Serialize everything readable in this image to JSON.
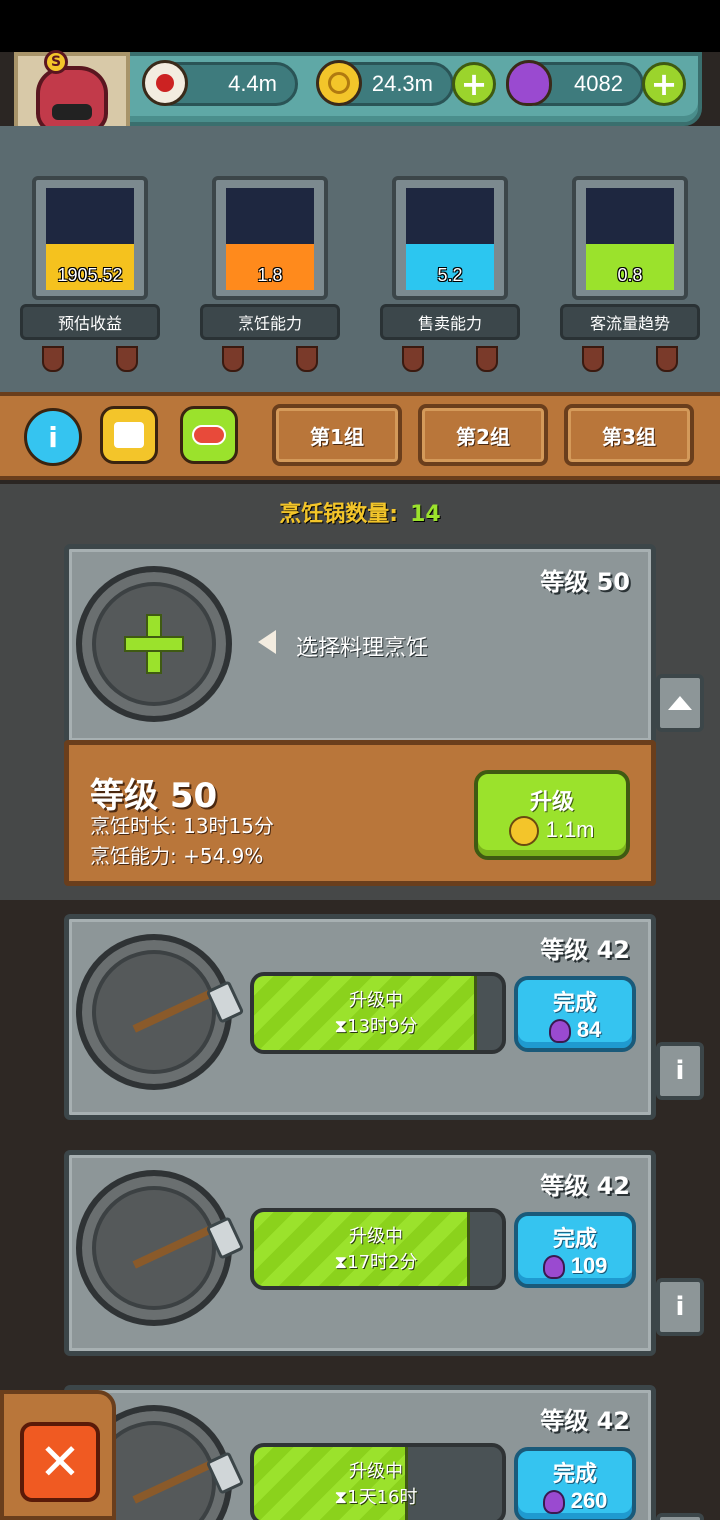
{
  "resources": {
    "eyes": "4.4m",
    "coins": "24.3m",
    "potions": "4082"
  },
  "stats": [
    {
      "value": "1905.52",
      "label": "预估收益",
      "color": "#f5c21e",
      "level": 0.45
    },
    {
      "value": "1.8",
      "label": "烹饪能力",
      "color": "#ff8a1c",
      "level": 0.45
    },
    {
      "value": "5.2",
      "label": "售卖能力",
      "color": "#2cc6f0",
      "level": 0.45
    },
    {
      "value": "0.8",
      "label": "客流量趋势",
      "color": "#9be22c",
      "level": 0.45
    }
  ],
  "toolbar": {
    "info_icon": "info-icon",
    "shirt_icon": "shirt-icon",
    "shoe_icon": "shoe-icon",
    "groups": [
      "第1组",
      "第2组",
      "第3组"
    ]
  },
  "pot_count": {
    "label": "烹饪锅数量:",
    "value": "14"
  },
  "card1": {
    "level": "等级 50",
    "select_text": "选择料理烹饪",
    "detail_level": "等级 50",
    "cook_time": "烹饪时长: 13时15分",
    "cook_power": "烹饪能力: +54.9%",
    "upgrade_label": "升级",
    "upgrade_cost": "1.1m"
  },
  "cards": [
    {
      "level": "等级 42",
      "status": "升级中",
      "timer": "⧗13时9分",
      "complete_label": "完成",
      "cost": "84",
      "progress": 0.9
    },
    {
      "level": "等级 42",
      "status": "升级中",
      "timer": "⧗17时2分",
      "complete_label": "完成",
      "cost": "109",
      "progress": 0.87
    },
    {
      "level": "等级 42",
      "status": "升级中",
      "timer": "⧗1天16时",
      "complete_label": "完成",
      "cost": "260",
      "progress": 0.62
    }
  ],
  "close_icon": "close-icon"
}
